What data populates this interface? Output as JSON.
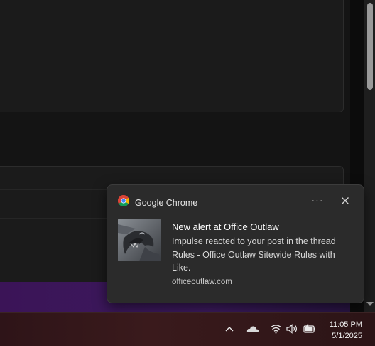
{
  "toast": {
    "app_name": "Google Chrome",
    "more_icon": "more-dots-icon",
    "close_icon": "close-icon",
    "title": "New alert at Office Outlaw",
    "body": "Impulse reacted to your post in the thread Rules - Office Outlaw Sitewide Rules with Like.",
    "source": "officeoutlaw.com",
    "image": "dragon-thumbnail"
  },
  "taskbar": {
    "tray_icons": [
      "chevron-up-icon",
      "onedrive-cloud-icon",
      "wifi-icon",
      "volume-icon",
      "battery-charging-icon"
    ],
    "clock": {
      "time": "11:05 PM",
      "date": "5/1/2025"
    }
  },
  "colors": {
    "toast_bg": "#2b2b2b",
    "app_bg": "#141414",
    "purple_band": "#3b1457",
    "taskbar": "#2e1418"
  }
}
